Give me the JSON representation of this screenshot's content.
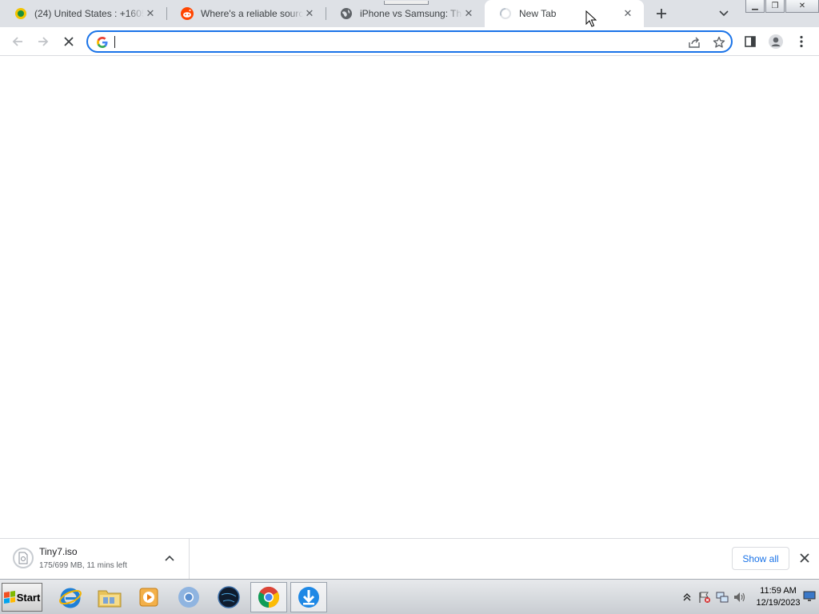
{
  "browser": {
    "tabs": [
      {
        "title": "(24) United States : +16050",
        "favicon": "whatsapp-style-icon"
      },
      {
        "title": "Where's a reliable source fo",
        "favicon": "reddit-icon"
      },
      {
        "title": "iPhone vs Samsung: The ulti",
        "favicon": "globe-icon"
      },
      {
        "title": "New Tab",
        "favicon": "loading-spinner-icon",
        "active": true
      }
    ],
    "omnibox": {
      "value": "",
      "placeholder": ""
    }
  },
  "download": {
    "file_name": "Tiny7.iso",
    "status": "175/699 MB, 11 mins left",
    "show_all_label": "Show all"
  },
  "taskbar": {
    "start_label": "Start",
    "apps": [
      "internet-explorer-icon",
      "file-explorer-icon",
      "media-player-icon",
      "chromium-icon",
      "globe-dark-icon",
      "chrome-icon",
      "download-manager-icon"
    ],
    "clock_time": "11:59 AM",
    "clock_date": "12/19/2023"
  },
  "colors": {
    "accent": "#1a73e8",
    "tabstrip": "#dee1e6"
  }
}
